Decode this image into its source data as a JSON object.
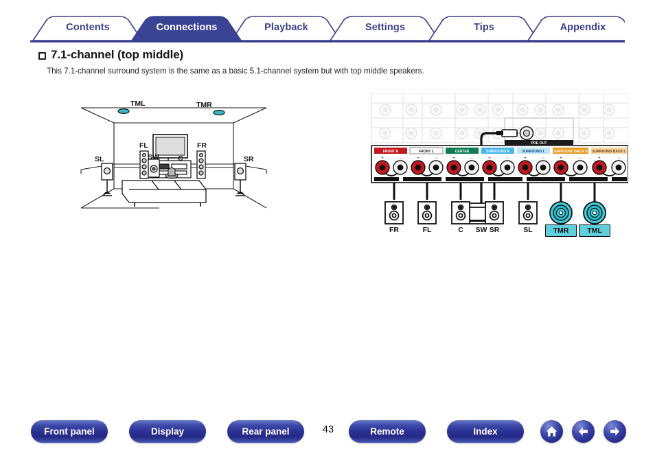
{
  "tabs": [
    {
      "label": "Contents",
      "active": false
    },
    {
      "label": "Connections",
      "active": true
    },
    {
      "label": "Playback",
      "active": false
    },
    {
      "label": "Settings",
      "active": false
    },
    {
      "label": "Tips",
      "active": false
    },
    {
      "label": "Appendix",
      "active": false
    }
  ],
  "heading": {
    "title": "7.1-channel (top middle)",
    "description": "This 7.1-channel surround system is the same as a basic 5.1-channel system but with top middle speakers."
  },
  "room_diagram": {
    "labels": [
      {
        "name": "TML",
        "text": "TML"
      },
      {
        "name": "TMR",
        "text": "TMR"
      },
      {
        "name": "FL",
        "text": "FL"
      },
      {
        "name": "FR",
        "text": "FR"
      },
      {
        "name": "SW",
        "text": "SW"
      },
      {
        "name": "C",
        "text": "C"
      },
      {
        "name": "SL",
        "text": "SL"
      },
      {
        "name": "SR",
        "text": "SR"
      }
    ]
  },
  "rear_panel": {
    "pre_out_label": "PRE OUT",
    "terminal_groups": [
      {
        "label": "FRONT R",
        "color": "#c3191e",
        "text_color": "#ffffff"
      },
      {
        "label": "FRONT L",
        "color": "#ffffff",
        "text_color": "#111111"
      },
      {
        "label": "CENTER",
        "color": "#0e7d52",
        "text_color": "#ffffff"
      },
      {
        "label": "SURROUND R",
        "color": "#45b7e8",
        "text_color": "#ffffff"
      },
      {
        "label": "SURROUND L",
        "color": "#bfe6f7",
        "text_color": "#12477a"
      },
      {
        "label": "SURROUND BACK R",
        "color": "#e79a20",
        "text_color": "#ffffff"
      },
      {
        "label": "SURROUND BACK L",
        "color": "#f3d4a0",
        "text_color": "#6b4208"
      }
    ],
    "polarity": {
      "plus": "+",
      "minus": "−"
    },
    "speakers": [
      {
        "name": "SW",
        "label": "SW",
        "type": "subwoofer",
        "highlight": false
      },
      {
        "name": "FR",
        "label": "FR",
        "type": "box",
        "highlight": false
      },
      {
        "name": "FL",
        "label": "FL",
        "type": "box",
        "highlight": false
      },
      {
        "name": "C",
        "label": "C",
        "type": "box",
        "highlight": false
      },
      {
        "name": "SR",
        "label": "SR",
        "type": "box",
        "highlight": false
      },
      {
        "name": "SL",
        "label": "SL",
        "type": "box",
        "highlight": false
      },
      {
        "name": "TMR",
        "label": "TMR",
        "type": "ceiling",
        "highlight": true
      },
      {
        "name": "TML",
        "label": "TML",
        "type": "ceiling",
        "highlight": true
      }
    ]
  },
  "footer": {
    "buttons": [
      {
        "name": "front-panel",
        "label": "Front panel"
      },
      {
        "name": "display",
        "label": "Display"
      },
      {
        "name": "rear-panel",
        "label": "Rear panel"
      },
      {
        "name": "remote",
        "label": "Remote"
      },
      {
        "name": "index",
        "label": "Index"
      }
    ],
    "page_number": "43",
    "icons": [
      {
        "name": "home-icon",
        "glyph": "home"
      },
      {
        "name": "back-icon",
        "glyph": "left"
      },
      {
        "name": "forward-icon",
        "glyph": "right"
      }
    ]
  },
  "colors": {
    "brand_blue": "#3a3f90",
    "active_tab": "#3b4395",
    "highlight_cyan": "#5ecfdd"
  }
}
